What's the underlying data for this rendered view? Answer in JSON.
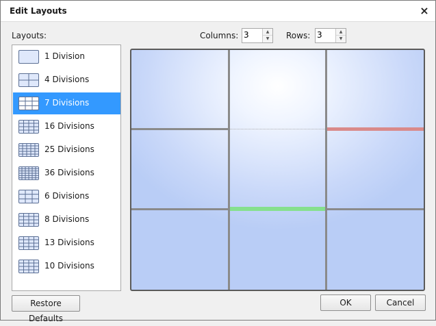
{
  "dialog": {
    "title": "Edit Layouts",
    "close_icon": "×"
  },
  "layouts": {
    "label": "Layouts:",
    "selected_index": 2,
    "items": [
      {
        "label": "1 Division",
        "icon": "layout-1-icon",
        "cols": 1,
        "rows": 1
      },
      {
        "label": "4 Divisions",
        "icon": "layout-4-icon",
        "cols": 2,
        "rows": 2
      },
      {
        "label": "7 Divisions",
        "icon": "layout-7-icon",
        "cols": 3,
        "rows": 3
      },
      {
        "label": "16 Divisions",
        "icon": "layout-16-icon",
        "cols": 4,
        "rows": 4
      },
      {
        "label": "25 Divisions",
        "icon": "layout-25-icon",
        "cols": 5,
        "rows": 5
      },
      {
        "label": "36 Divisions",
        "icon": "layout-36-icon",
        "cols": 6,
        "rows": 6
      },
      {
        "label": "6 Divisions",
        "icon": "layout-6-icon",
        "cols": 3,
        "rows": 3
      },
      {
        "label": "8 Divisions",
        "icon": "layout-8-icon",
        "cols": 4,
        "rows": 4
      },
      {
        "label": "13 Divisions",
        "icon": "layout-13-icon",
        "cols": 4,
        "rows": 4
      },
      {
        "label": "10 Divisions",
        "icon": "layout-10-icon",
        "cols": 4,
        "rows": 4
      }
    ]
  },
  "grid_controls": {
    "columns_label": "Columns:",
    "columns_value": "3",
    "rows_label": "Rows:",
    "rows_value": "3"
  },
  "preview": {
    "columns": 3,
    "rows": 3
  },
  "buttons": {
    "restore": "Restore Defaults",
    "ok": "OK",
    "cancel": "Cancel"
  },
  "colors": {
    "selection": "#3399ff",
    "merged_edge": "#c0c0c0",
    "highlight_green": "#7fe08a",
    "highlight_red": "#e08a8a",
    "grid_line": "#8a8a8a"
  }
}
